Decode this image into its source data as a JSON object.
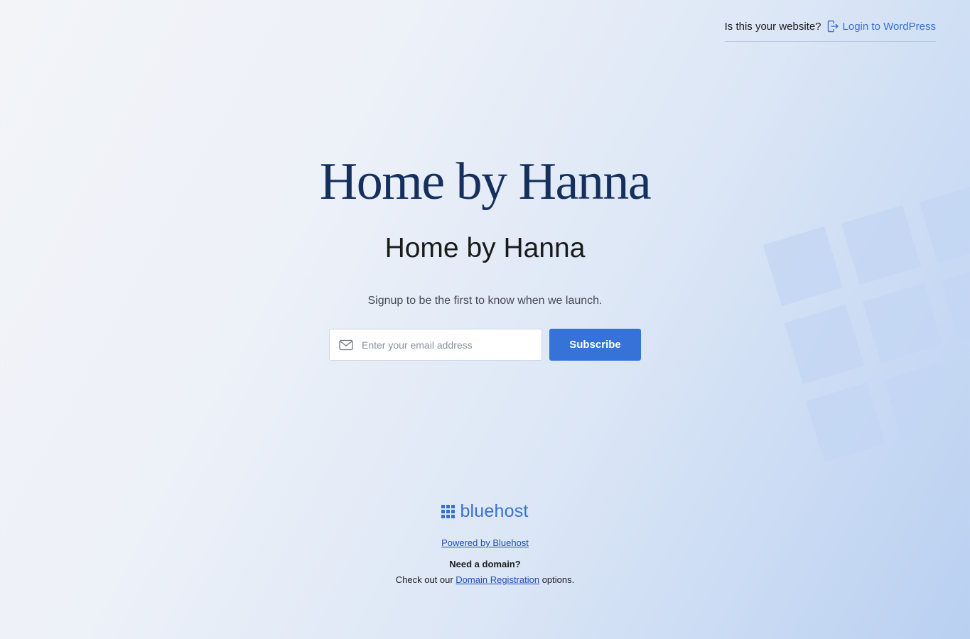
{
  "top_bar": {
    "question": "Is this your website?",
    "login_label": "Login to WordPress"
  },
  "hero": {
    "logo_text": "Home by Hanna",
    "site_title": "Home by Hanna",
    "tagline": "Signup to be the first to know when we launch."
  },
  "signup": {
    "email_placeholder": "Enter your email address",
    "email_value": "",
    "subscribe_label": "Subscribe"
  },
  "footer": {
    "brand": "bluehost",
    "powered_by": "Powered by Bluehost",
    "need_domain": "Need a domain?",
    "check_out_prefix": "Check out our ",
    "domain_link": "Domain Registration",
    "check_out_suffix": " options."
  },
  "icons": {
    "login": "login-icon",
    "email": "envelope-icon",
    "brand": "bluehost-grid-icon"
  },
  "colors": {
    "accent": "#3573d8",
    "link": "#3a6fd0",
    "logo_text": "#16305d"
  }
}
